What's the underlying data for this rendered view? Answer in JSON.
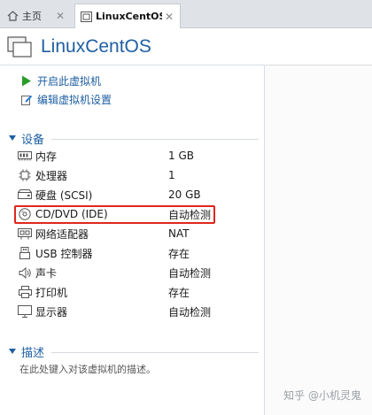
{
  "tabs": [
    {
      "label": "主页",
      "icon": "home-icon"
    },
    {
      "label": "LinuxCentOS",
      "icon": "vm-tab-icon"
    }
  ],
  "vm": {
    "name": "LinuxCentOS"
  },
  "actions": [
    {
      "label": "开启此虚拟机",
      "icon": "play-icon"
    },
    {
      "label": "编辑虚拟机设置",
      "icon": "edit-settings-icon"
    }
  ],
  "devices_section": {
    "title": "设备",
    "items": [
      {
        "name": "内存",
        "value": "1 GB",
        "icon": "memory-icon"
      },
      {
        "name": "处理器",
        "value": "1",
        "icon": "processor-icon"
      },
      {
        "name": "硬盘 (SCSI)",
        "value": "20 GB",
        "icon": "hard-disk-icon"
      },
      {
        "name": "CD/DVD (IDE)",
        "value": "自动检测",
        "icon": "cd-dvd-icon"
      },
      {
        "name": "网络适配器",
        "value": "NAT",
        "icon": "network-adapter-icon"
      },
      {
        "name": "USB 控制器",
        "value": "存在",
        "icon": "usb-icon"
      },
      {
        "name": "声卡",
        "value": "自动检测",
        "icon": "sound-card-icon"
      },
      {
        "name": "打印机",
        "value": "存在",
        "icon": "printer-icon"
      },
      {
        "name": "显示器",
        "value": "自动检测",
        "icon": "display-icon"
      }
    ]
  },
  "description_section": {
    "title": "描述",
    "placeholder": "在此处键入对该虚拟机的描述。"
  },
  "watermark": "知乎 @小机灵鬼",
  "colors": {
    "accent": "#1f5fa3",
    "highlight": "#e0261d",
    "play": "#2a9d2a"
  }
}
